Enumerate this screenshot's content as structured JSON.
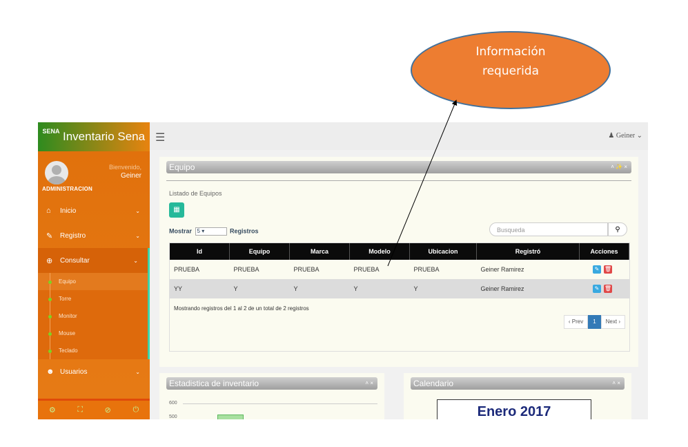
{
  "callout": {
    "line1": "Información",
    "line2": "requerida"
  },
  "brand": {
    "logo_text": "SENA",
    "title": "Inventario Sena"
  },
  "profile": {
    "welcome": "Bienvenido,",
    "name": "Geiner",
    "role": "ADMINISTRACION"
  },
  "menu": [
    {
      "label": "Inicio",
      "icon": "home-icon"
    },
    {
      "label": "Registro",
      "icon": "edit-icon"
    },
    {
      "label": "Consultar",
      "icon": "search-plus-icon"
    },
    {
      "label": "Usuarios",
      "icon": "users-icon"
    }
  ],
  "submenu": [
    "Equipo",
    "Torre",
    "Monitor",
    "Mouse",
    "Teclado"
  ],
  "topbar": {
    "user": "Geiner"
  },
  "equipo_panel": {
    "title": "Equipo",
    "subtitle": "Listado de Equipos",
    "show_label": "Mostrar",
    "show_value": "5",
    "records_label": "Registros",
    "search_placeholder": "Busqueda",
    "columns": [
      "Id",
      "Equipo",
      "Marca",
      "Modelo",
      "Ubicacion",
      "Registró",
      "Acciones"
    ],
    "rows": [
      [
        "PRUEBA",
        "PRUEBA",
        "PRUEBA",
        "PRUEBA",
        "PRUEBA",
        "Geiner Ramirez"
      ],
      [
        "YY",
        "Y",
        "Y",
        "Y",
        "Y",
        "Geiner Ramirez"
      ]
    ],
    "summary": "Mostrando registros del 1 al 2 de un total de 2 registros",
    "pager": {
      "prev": "‹ Prev",
      "current": "1",
      "next": "Next ›"
    }
  },
  "stats_panel": {
    "title": "Estadistica de inventario",
    "tick_600": "600",
    "tick_500": "500"
  },
  "calendar_panel": {
    "title": "Calendario",
    "month": "Enero 2017"
  }
}
